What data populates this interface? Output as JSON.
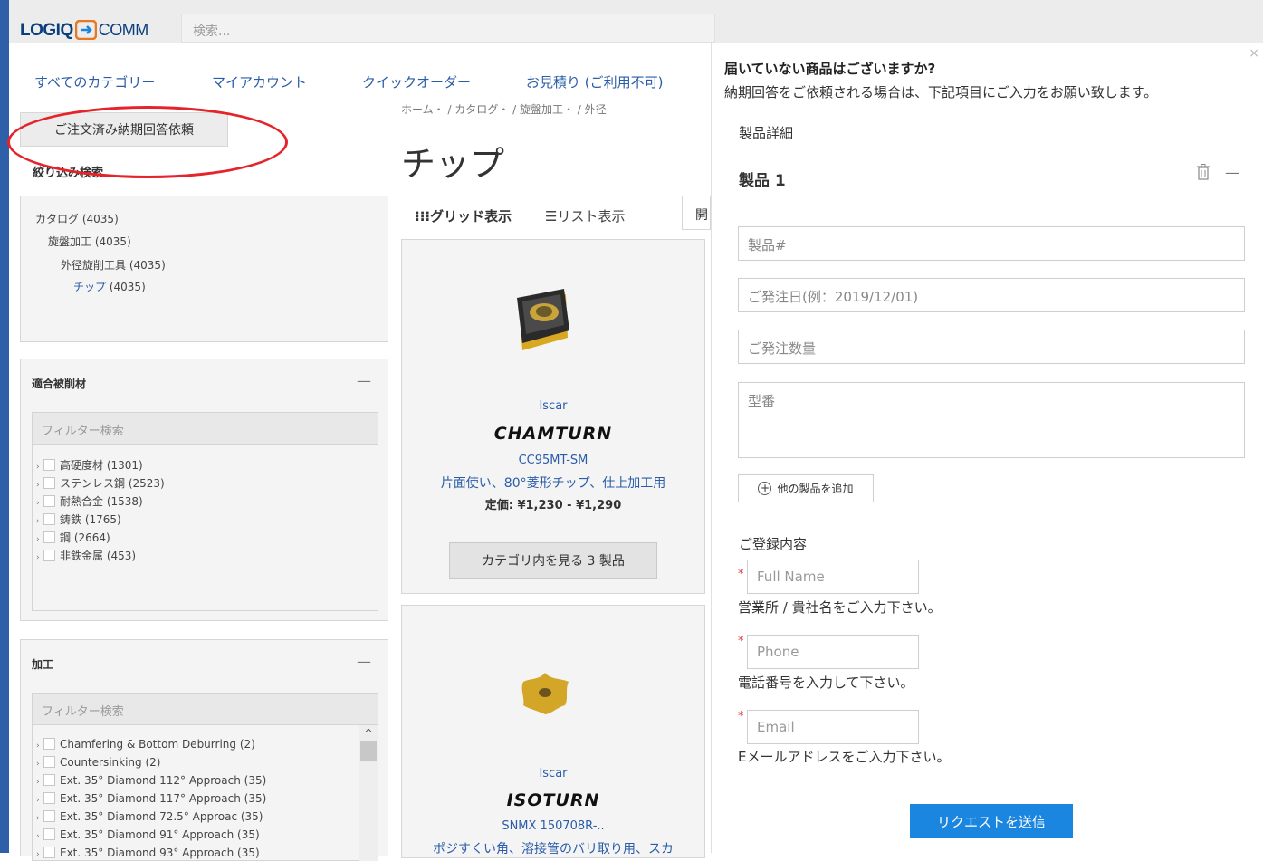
{
  "header": {
    "logo_left": "LOGIQ",
    "logo_right": "COMM",
    "search_placeholder": "検索..."
  },
  "nav": {
    "items": [
      "すべてのカテゴリー",
      "マイアカウント",
      "クイックオーダー",
      "お見積り (ご利用不可)"
    ]
  },
  "breadcrumb": "ホーム・ / カタログ・ / 旋盤加工・ / 外径",
  "order_button": "ご注文済み納期回答依頼",
  "filter_title": "絞り込み検索",
  "categories": [
    {
      "label": "カタログ",
      "count": "(4035)"
    },
    {
      "label": "旋盤加工",
      "count": "(4035)"
    },
    {
      "label": "外径旋削工具",
      "count": "(4035)"
    },
    {
      "label": "チップ",
      "count": "(4035)"
    }
  ],
  "material_section": {
    "title": "適合被削材",
    "filter_placeholder": "フィルター検索",
    "items": [
      "高硬度材 (1301)",
      "ステンレス鋼 (2523)",
      "耐熱合金 (1538)",
      "鋳鉄 (1765)",
      "鋼 (2664)",
      "非鉄金属 (453)"
    ]
  },
  "machining_section": {
    "title": "加工",
    "filter_placeholder": "フィルター検索",
    "items": [
      "Chamfering & Bottom Deburring (2)",
      "Countersinking (2)",
      "Ext. 35° Diamond 112° Approach (35)",
      "Ext. 35° Diamond 117° Approach (35)",
      "Ext. 35° Diamond 72.5° Approac (35)",
      "Ext. 35° Diamond 91° Approach (35)",
      "Ext. 35° Diamond 93° Approach (35)"
    ]
  },
  "page_title": "チップ",
  "view": {
    "grid": "グリッド表示",
    "list": "リスト表示",
    "sort_partial": "開"
  },
  "products": [
    {
      "brand": "Iscar",
      "series": "CHAMTURN",
      "code": "CC95MT-SM",
      "desc": "片面使い、80°菱形チップ、仕上加工用",
      "price": "定価: ¥1,230 - ¥1,290",
      "button": "カテゴリ内を見る 3 製品"
    },
    {
      "brand": "Iscar",
      "series": "ISOTURN",
      "code": "SNMX 150708R-..",
      "desc": "ポジすくい角、溶接管のバリ取り用、スカ"
    }
  ],
  "modal": {
    "close": "×",
    "title": "届いていない商品はございますか?",
    "subtitle": "納期回答をご依頼される場合は、下記項目にご入力をお願い致します。",
    "product_details": "製品詳細",
    "product_label": "製品 1",
    "fields": {
      "product_no": "製品#",
      "order_date": "ご発注日(例：2019/12/01)",
      "order_qty": "ご発注数量",
      "model_no": "型番"
    },
    "add_product": "他の製品を追加",
    "registration": "ご登録内容",
    "full_name": "Full Name",
    "full_name_hint": "営業所 / 貴社名をご入力下さい。",
    "phone": "Phone",
    "phone_hint": "電話番号を入力して下さい。",
    "email": "Email",
    "email_hint": "Eメールアドレスをご入力下さい。",
    "submit": "リクエストを送信"
  },
  "colors": {
    "accent": "#2a5ca8",
    "submit": "#1a86e0",
    "annotation": "#e5232a",
    "required": "#e23b3b"
  }
}
